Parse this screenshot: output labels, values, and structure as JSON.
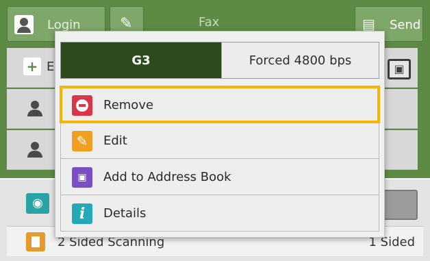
{
  "header": {
    "login_label": "Login",
    "title": "Fax",
    "send_label": "Send"
  },
  "background": {
    "add_recipient_label": "E",
    "sided_row": {
      "label": "2 Sided Scanning",
      "value": "1 Sided"
    }
  },
  "popup": {
    "segment": [
      {
        "label": "G3",
        "selected": true
      },
      {
        "label": "Forced 4800 bps",
        "selected": false
      }
    ],
    "menu_items": [
      {
        "label": "Remove",
        "icon": "remove-icon",
        "color": "#d9364a",
        "selected": true
      },
      {
        "label": "Edit",
        "icon": "pencil-icon",
        "color": "#f0a020",
        "selected": false
      },
      {
        "label": "Add to Address Book",
        "icon": "address-book-add-icon",
        "color": "#7b4fc4",
        "selected": false
      },
      {
        "label": "Details",
        "icon": "info-icon",
        "color": "#27a8b6",
        "selected": false
      }
    ]
  },
  "colors": {
    "header_green": "#5d8b45",
    "segment_selected": "#2c4a1e",
    "focus_outline": "#f5b400"
  }
}
